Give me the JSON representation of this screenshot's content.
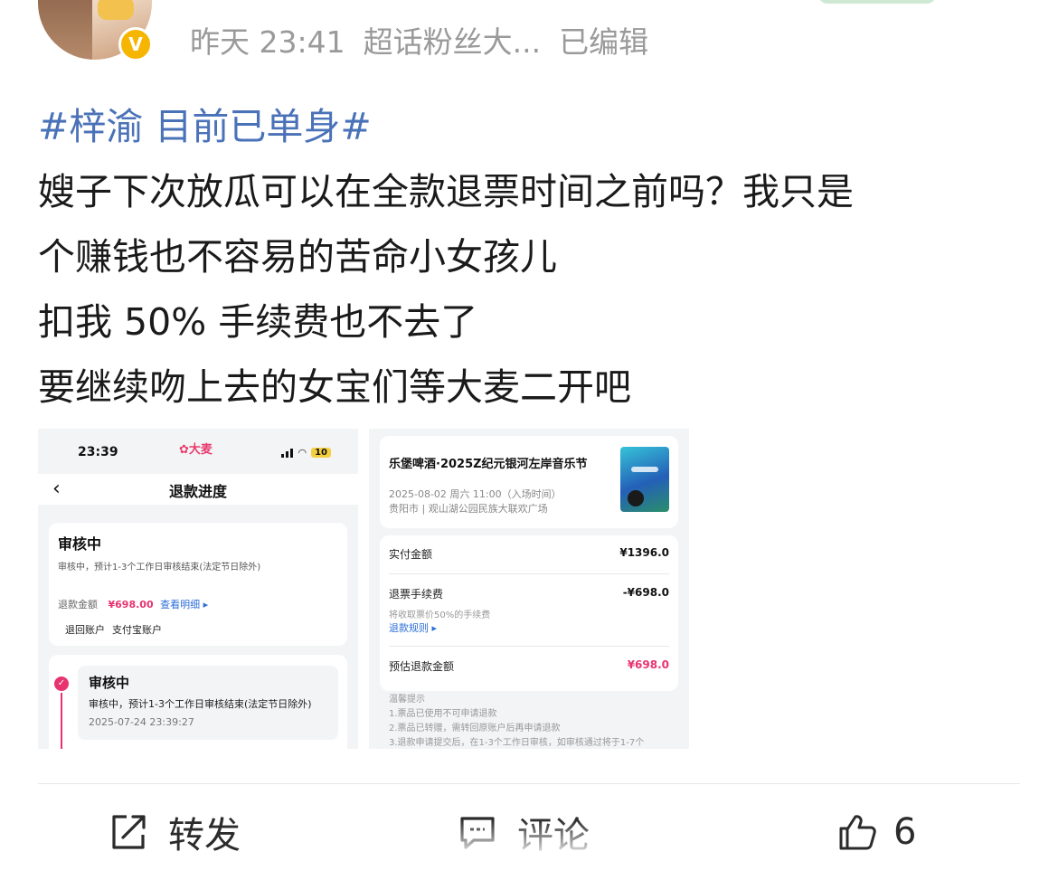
{
  "header": {
    "time": "昨天 23:41",
    "source": "超话粉丝大...",
    "edited": "已编辑",
    "verified_badge": "V"
  },
  "post": {
    "hashtag": "#梓渝 目前已单身#",
    "lines": [
      "嫂子下次放瓜可以在全款退票时间之前吗？我只是",
      "个赚钱也不容易的苦命小女孩儿",
      "扣我 50% 手续费也不去了",
      "要继续吻上去的女宝们等大麦二开吧"
    ]
  },
  "image1": {
    "status_time": "23:39",
    "brand": "大麦",
    "battery": "10",
    "nav_back": "‹",
    "nav_title": "退款进度",
    "status_title": "审核中",
    "status_desc": "审核中，预计1-3个工作日审核结束(法定节日除外)",
    "refund_amount_label": "退款金额",
    "refund_amount": "¥698.00",
    "detail_link": "查看明细 ▸",
    "refund_account_label": "退回账户",
    "refund_account": "支付宝账户",
    "timeline_title": "审核中",
    "timeline_desc": "审核中，预计1-3个工作日审核结束(法定节日除外)",
    "timeline_time": "2025-07-24 23:39:27"
  },
  "image2": {
    "event_title": "乐堡啤酒·2025Z纪元银河左岸音乐节",
    "event_date": "2025-08-02 周六 11:00（入场时间）",
    "event_venue": "贵阳市 | 观山湖公园民族大联欢广场",
    "paid_label": "实付金额",
    "paid_value": "¥1396.0",
    "fee_label": "退票手续费",
    "fee_value": "-¥698.0",
    "fee_note": "将收取票价50%的手续费",
    "fee_rules": "退款规则 ▸",
    "est_label": "预估退款金额",
    "est_value": "¥698.0",
    "tips_title": "温馨提示",
    "tip1": "1.票品已使用不可申请退款",
    "tip2": "2.票品已转赠，需转回原账户后再申请退款",
    "tip3": "3.退款申请提交后，在1-3个工作日审核，如审核通过将于1-7个"
  },
  "actions": {
    "repost_label": "转发",
    "comment_label": "评论",
    "like_count": "6"
  },
  "colors": {
    "hashtag": "#4a72b8",
    "brand_pink": "#e8336f",
    "link_blue": "#2f6fd6",
    "meta_gray": "#9a9a9a",
    "badge_yellow": "#f6b500"
  }
}
